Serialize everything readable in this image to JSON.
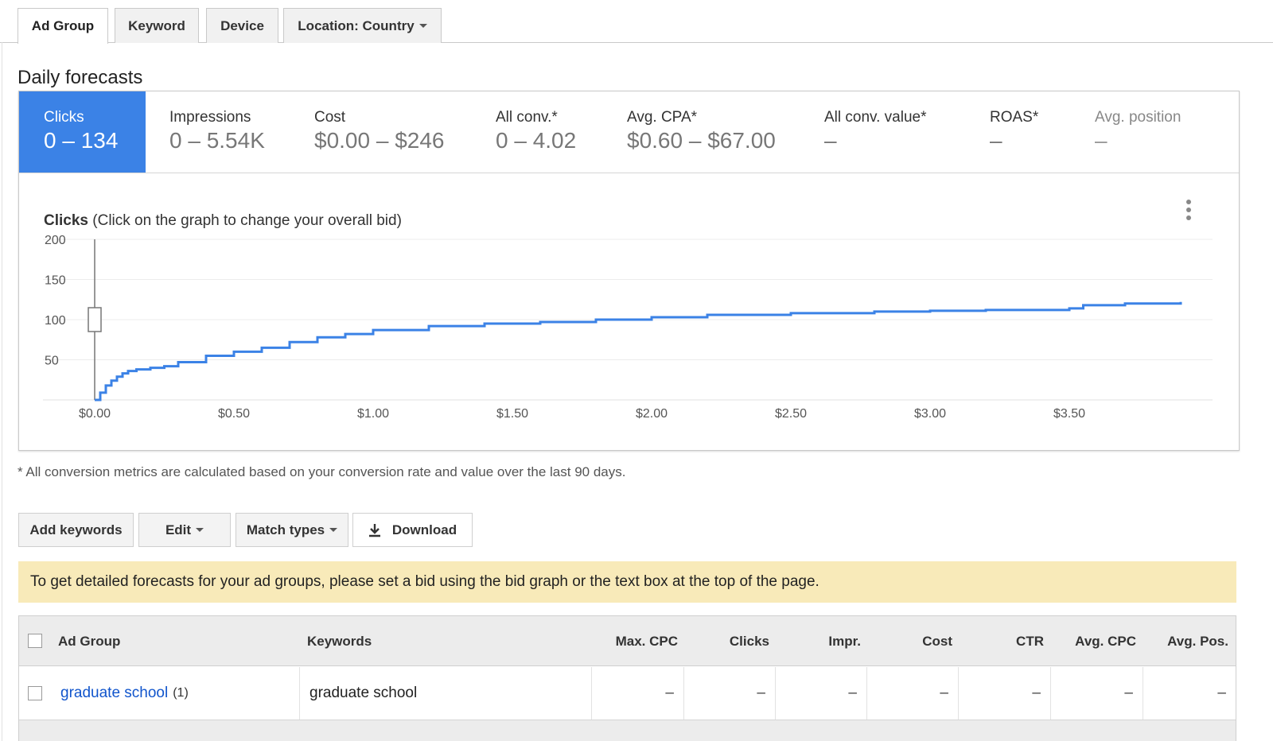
{
  "tabs": [
    {
      "label": "Ad Group",
      "active": true
    },
    {
      "label": "Keyword"
    },
    {
      "label": "Device"
    },
    {
      "label": "Location: Country"
    }
  ],
  "section_title": "Daily forecasts",
  "metrics": [
    {
      "label": "Clicks",
      "value": "0 – 134",
      "active": true
    },
    {
      "label": "Impressions",
      "value": "0 – 5.54K"
    },
    {
      "label": "Cost",
      "value": "$0.00 – $246"
    },
    {
      "label": "All conv.*",
      "value": "0 – 4.02"
    },
    {
      "label": "Avg. CPA*",
      "value": "$0.60 – $67.00"
    },
    {
      "label": "All conv. value*",
      "value": "–"
    },
    {
      "label": "ROAS*",
      "value": "–"
    },
    {
      "label": "Avg. position",
      "value": "–",
      "dimmed": true
    }
  ],
  "chart_title_bold": "Clicks",
  "chart_title_rest": "(Click on the graph to change your overall bid)",
  "chart_data": {
    "type": "line",
    "series": [
      {
        "x": [
          0.0,
          0.02,
          0.04,
          0.06,
          0.08,
          0.1,
          0.12,
          0.15,
          0.2,
          0.25,
          0.3,
          0.4,
          0.5,
          0.6,
          0.7,
          0.8,
          0.9,
          1.0,
          1.2,
          1.4,
          1.6,
          1.8,
          2.0,
          2.2,
          2.5,
          2.8,
          3.0,
          3.2,
          3.5,
          3.55,
          3.7,
          3.9
        ],
        "y": [
          0,
          9,
          18,
          24,
          29,
          33,
          36,
          38,
          40,
          42,
          47,
          55,
          60,
          65,
          72,
          78,
          82,
          87,
          92,
          95,
          97,
          100,
          103,
          106,
          108,
          110,
          111,
          112,
          114,
          118,
          120,
          122
        ]
      }
    ],
    "xticks": [
      "$0.00",
      "$0.50",
      "$1.00",
      "$1.50",
      "$2.00",
      "$2.50",
      "$3.00",
      "$3.50"
    ],
    "yticks": [
      "200",
      "150",
      "100",
      "50"
    ],
    "xlim": [
      0,
      4.0
    ],
    "ylim": [
      0,
      200
    ],
    "bid_marker": {
      "x": 0.0,
      "y": 100
    },
    "grid": true,
    "color": "#3b82e6"
  },
  "footnote": "* All conversion metrics are calculated based on your conversion rate and value over the last 90 days.",
  "toolbar": {
    "add_keywords": "Add keywords",
    "edit": "Edit",
    "match_types": "Match types",
    "download": "Download"
  },
  "notice": "To get detailed forecasts for your ad groups, please set a bid using the bid graph or the text box at the top of the page.",
  "table": {
    "headers": [
      "Ad Group",
      "Keywords",
      "Max. CPC",
      "Clicks",
      "Impr.",
      "Cost",
      "CTR",
      "Avg. CPC",
      "Avg. Pos."
    ],
    "rows": [
      {
        "ad_group": "graduate school",
        "count": "(1)",
        "keywords": "graduate school",
        "values": [
          "–",
          "–",
          "–",
          "–",
          "–",
          "–",
          "–"
        ]
      }
    ]
  }
}
